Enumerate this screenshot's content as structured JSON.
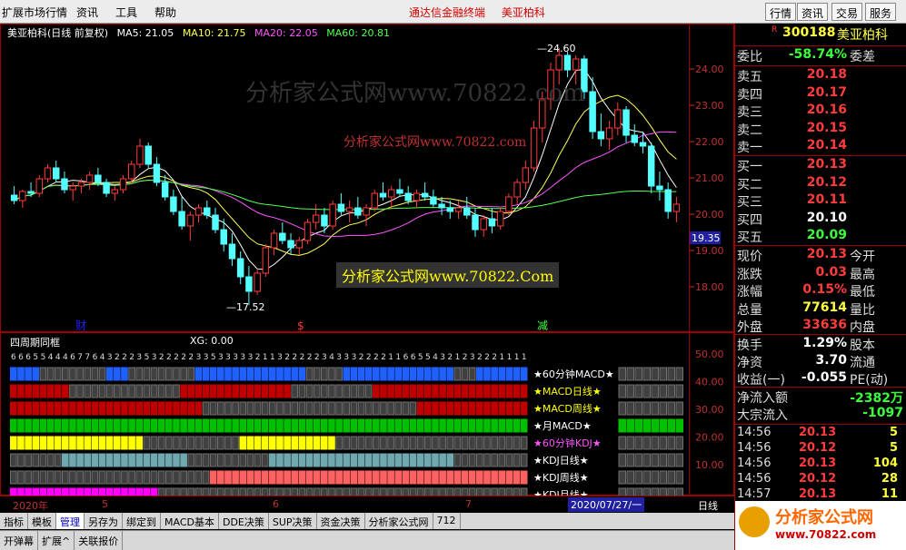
{
  "menu": {
    "items": [
      "扩展市场行情",
      "资讯",
      "工具",
      "帮助"
    ],
    "center": [
      "通达信金融终端",
      "美亚柏科"
    ],
    "right_buttons": [
      "行情",
      "资讯",
      "交易",
      "服务"
    ]
  },
  "chart": {
    "title": "美亚柏科(日线 前复权)",
    "ma": [
      {
        "label": "MA5: 21.05",
        "color": "#ffffff"
      },
      {
        "label": "MA10: 21.75",
        "color": "#ffff55"
      },
      {
        "label": "MA20: 22.05",
        "color": "#ff55ff"
      },
      {
        "label": "MA60: 20.81",
        "color": "#55ff55"
      }
    ],
    "high_label": "24.60",
    "low_label": "17.52",
    "price_ticks": [
      "24.00",
      "23.00",
      "22.00",
      "21.00",
      "20.00",
      "19.00",
      "18.00"
    ],
    "current_price_tag": "19.35",
    "markers": [
      "财",
      "$",
      "减"
    ],
    "watermarks": [
      "分析家公式网www.70822.com",
      "分析家公式网www.70822.com",
      "分析家公式网www.70822.Com"
    ]
  },
  "chart_data": {
    "type": "candlestick",
    "candles": [
      [
        20.55,
        20.8,
        20.3,
        20.4
      ],
      [
        20.4,
        20.7,
        20.2,
        20.65
      ],
      [
        20.65,
        20.9,
        20.5,
        20.6
      ],
      [
        20.6,
        21.1,
        20.5,
        21.0
      ],
      [
        21.0,
        21.4,
        20.9,
        21.3
      ],
      [
        21.3,
        21.5,
        20.9,
        21.0
      ],
      [
        21.0,
        21.2,
        20.6,
        20.7
      ],
      [
        20.7,
        20.9,
        20.4,
        20.8
      ],
      [
        20.8,
        21.0,
        20.6,
        20.9
      ],
      [
        20.9,
        21.2,
        20.7,
        21.1
      ],
      [
        21.1,
        21.3,
        20.8,
        20.9
      ],
      [
        20.9,
        21.0,
        20.5,
        20.6
      ],
      [
        20.6,
        20.8,
        20.4,
        20.7
      ],
      [
        20.7,
        21.1,
        20.6,
        21.0
      ],
      [
        21.0,
        21.5,
        20.9,
        21.4
      ],
      [
        21.4,
        22.1,
        21.3,
        21.9
      ],
      [
        21.9,
        22.0,
        21.3,
        21.4
      ],
      [
        21.4,
        21.6,
        20.8,
        20.9
      ],
      [
        20.9,
        21.1,
        20.4,
        20.5
      ],
      [
        20.5,
        20.7,
        20.0,
        20.1
      ],
      [
        20.1,
        20.5,
        19.6,
        19.7
      ],
      [
        19.7,
        20.1,
        19.3,
        20.0
      ],
      [
        20.0,
        20.3,
        19.8,
        20.2
      ],
      [
        20.2,
        20.4,
        19.9,
        20.0
      ],
      [
        20.0,
        20.2,
        19.5,
        19.6
      ],
      [
        19.6,
        19.9,
        19.0,
        19.2
      ],
      [
        19.2,
        19.5,
        18.6,
        18.8
      ],
      [
        18.8,
        19.0,
        18.1,
        18.3
      ],
      [
        18.3,
        18.6,
        17.52,
        17.9
      ],
      [
        17.9,
        18.5,
        17.8,
        18.4
      ],
      [
        18.4,
        19.2,
        18.3,
        19.1
      ],
      [
        19.1,
        19.6,
        18.9,
        19.5
      ],
      [
        19.5,
        19.8,
        19.2,
        19.3
      ],
      [
        19.3,
        19.5,
        18.9,
        19.1
      ],
      [
        19.1,
        19.4,
        18.9,
        19.3
      ],
      [
        19.3,
        19.9,
        19.2,
        19.8
      ],
      [
        19.8,
        20.3,
        19.6,
        20.0
      ],
      [
        20.0,
        20.2,
        19.5,
        19.7
      ],
      [
        19.7,
        20.4,
        19.6,
        20.3
      ],
      [
        20.3,
        20.6,
        20.0,
        20.1
      ],
      [
        20.1,
        20.4,
        19.8,
        20.2
      ],
      [
        20.2,
        20.5,
        19.9,
        20.0
      ],
      [
        20.0,
        20.3,
        19.7,
        20.2
      ],
      [
        20.2,
        20.7,
        20.1,
        20.6
      ],
      [
        20.6,
        20.9,
        20.4,
        20.5
      ],
      [
        20.5,
        20.8,
        20.2,
        20.7
      ],
      [
        20.7,
        21.0,
        20.5,
        20.6
      ],
      [
        20.6,
        20.8,
        20.3,
        20.4
      ],
      [
        20.4,
        20.7,
        20.2,
        20.6
      ],
      [
        20.6,
        20.9,
        20.4,
        20.5
      ],
      [
        20.5,
        20.7,
        20.2,
        20.3
      ],
      [
        20.3,
        20.5,
        20.0,
        20.2
      ],
      [
        20.2,
        20.4,
        19.9,
        20.1
      ],
      [
        20.1,
        20.4,
        19.9,
        20.2
      ],
      [
        20.2,
        20.5,
        19.9,
        20.0
      ],
      [
        20.0,
        20.2,
        19.4,
        19.6
      ],
      [
        19.6,
        20.0,
        19.4,
        19.9
      ],
      [
        19.9,
        20.2,
        19.5,
        19.7
      ],
      [
        19.7,
        20.2,
        19.6,
        20.1
      ],
      [
        20.1,
        20.6,
        20.0,
        20.5
      ],
      [
        20.5,
        21.0,
        20.3,
        20.9
      ],
      [
        20.9,
        21.5,
        20.7,
        21.3
      ],
      [
        21.3,
        22.6,
        21.2,
        22.4
      ],
      [
        22.4,
        23.4,
        22.0,
        23.2
      ],
      [
        23.2,
        24.2,
        22.9,
        24.0
      ],
      [
        24.0,
        24.6,
        23.6,
        24.4
      ],
      [
        24.4,
        24.5,
        23.8,
        24.0
      ],
      [
        24.0,
        24.4,
        23.6,
        24.3
      ],
      [
        24.3,
        24.4,
        23.2,
        23.4
      ],
      [
        23.4,
        23.8,
        22.1,
        22.3
      ],
      [
        22.3,
        22.8,
        21.9,
        22.1
      ],
      [
        22.1,
        22.6,
        21.8,
        22.4
      ],
      [
        22.4,
        23.1,
        22.2,
        22.9
      ],
      [
        22.9,
        23.0,
        22.0,
        22.2
      ],
      [
        22.2,
        22.5,
        21.9,
        22.0
      ],
      [
        22.0,
        22.3,
        21.7,
        21.9
      ],
      [
        21.9,
        22.0,
        20.6,
        20.8
      ],
      [
        20.8,
        21.2,
        20.4,
        20.7
      ],
      [
        20.7,
        20.9,
        19.9,
        20.1
      ],
      [
        20.1,
        20.5,
        19.8,
        20.3
      ]
    ],
    "ylim": [
      17.0,
      25.0
    ]
  },
  "indicator": {
    "title": "四周期同框",
    "xg": "XG: 0.00",
    "digits": "6665544467764322235322222335333332113222223433322221166554321232221111",
    "rows": [
      {
        "label": "★60分钟MACD★",
        "label_color": "#ffffff",
        "on": "#2060ff",
        "off": "#404040"
      },
      {
        "label": "★MACD日线★",
        "label_color": "#ffff00",
        "on": "#c00000",
        "off": "#404040"
      },
      {
        "label": "★MACD周线★",
        "label_color": "#ffff00",
        "on": "#c00000",
        "off": "#404040"
      },
      {
        "label": "★月MACD★",
        "label_color": "#ffffff",
        "on": "#00c000",
        "off": "#404040"
      },
      {
        "label": "★60分钟KDJ★",
        "label_color": "#ff55ff",
        "on": "#ffff00",
        "off": "#404040"
      },
      {
        "label": "★KDJ日线★",
        "label_color": "#ffffff",
        "on": "#70a8b0",
        "off": "#404040"
      },
      {
        "label": "★KDJ周线★",
        "label_color": "#ffffff",
        "on": "#ff6060",
        "off": "#404040"
      },
      {
        "label": "★KDJ月线★",
        "label_color": "#ffffff",
        "on": "#ff00ff",
        "off": "#404040"
      }
    ],
    "axis_ticks": [
      "50.00",
      "40.00",
      "30.00",
      "20.00",
      "10.00"
    ]
  },
  "datebar": {
    "labels": [
      "2020年",
      "5",
      "6",
      "7"
    ],
    "current": "2020/07/27/一",
    "period": "日线"
  },
  "tabs": [
    "指标",
    "模板",
    "管理",
    "另存为",
    "绑定到",
    "MACD基本",
    "DDE决策",
    "SUP决策",
    "资金决策",
    "分析家公式网",
    "712"
  ],
  "statusbar": [
    "开弹幕",
    "扩展^",
    "关联报价"
  ],
  "quote": {
    "code": "300188",
    "name": "美亚柏科",
    "webi": {
      "label": "委比",
      "value": "-58.74%",
      "label2": "委差"
    },
    "sell": [
      {
        "label": "卖五",
        "price": "20.18"
      },
      {
        "label": "卖四",
        "price": "20.17"
      },
      {
        "label": "卖三",
        "price": "20.16"
      },
      {
        "label": "卖二",
        "price": "20.15"
      },
      {
        "label": "卖一",
        "price": "20.14"
      }
    ],
    "buy": [
      {
        "label": "买一",
        "price": "20.13"
      },
      {
        "label": "买二",
        "price": "20.12"
      },
      {
        "label": "买三",
        "price": "20.11"
      },
      {
        "label": "买四",
        "price": "20.10"
      },
      {
        "label": "买五",
        "price": "20.09"
      }
    ],
    "stats": [
      {
        "label": "现价",
        "value": "20.13",
        "color": "red",
        "label2": "今开"
      },
      {
        "label": "涨跌",
        "value": "0.03",
        "color": "red",
        "label2": "最高"
      },
      {
        "label": "涨幅",
        "value": "0.15%",
        "color": "red",
        "label2": "最低"
      },
      {
        "label": "总量",
        "value": "77614",
        "color": "yellow",
        "label2": "量比"
      },
      {
        "label": "外盘",
        "value": "33636",
        "color": "red",
        "label2": "内盘"
      }
    ],
    "stats2": [
      {
        "label": "换手",
        "value": "1.29%",
        "color": "white",
        "label2": "股本"
      },
      {
        "label": "净资",
        "value": "3.70",
        "color": "white",
        "label2": "流通"
      },
      {
        "label": "收益(一)",
        "value": "-0.055",
        "color": "white",
        "label2": "PE(动)"
      }
    ],
    "flows": [
      {
        "label": "净流入额",
        "value": "-2382万"
      },
      {
        "label": "大宗流入",
        "value": "-1097"
      }
    ],
    "ticks": [
      {
        "time": "14:56",
        "price": "20.13",
        "vol": "5",
        "color": "red"
      },
      {
        "time": "14:56",
        "price": "20.12",
        "vol": "5",
        "color": "red"
      },
      {
        "time": "14:56",
        "price": "20.13",
        "vol": "104",
        "color": "red"
      },
      {
        "time": "14:56",
        "price": "20.12",
        "vol": "28",
        "color": "red"
      },
      {
        "time": "14:57",
        "price": "20.13",
        "vol": "11",
        "color": "red"
      }
    ],
    "logo": {
      "text": "分析家公式网",
      "url": "www.70822.com"
    }
  },
  "colors": {
    "up": "#ff3c3c",
    "down": "#54ffff",
    "grid": "#a00000"
  }
}
